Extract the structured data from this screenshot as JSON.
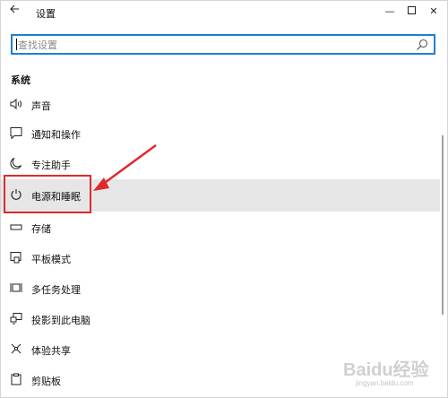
{
  "window": {
    "title": "设置",
    "back_icon": "back-arrow-icon",
    "minimize": "—",
    "close": "✕"
  },
  "search": {
    "placeholder": "查找设置",
    "icon": "search-icon"
  },
  "section_title": "系统",
  "items": [
    {
      "label": "声音",
      "icon": "speaker-icon"
    },
    {
      "label": "通知和操作",
      "icon": "notification-icon"
    },
    {
      "label": "专注助手",
      "icon": "moon-icon"
    },
    {
      "label": "电源和睡眠",
      "icon": "power-icon",
      "selected": true
    },
    {
      "label": "存储",
      "icon": "storage-icon"
    },
    {
      "label": "平板模式",
      "icon": "tablet-mode-icon"
    },
    {
      "label": "多任务处理",
      "icon": "multitasking-icon"
    },
    {
      "label": "投影到此电脑",
      "icon": "project-icon"
    },
    {
      "label": "体验共享",
      "icon": "shared-experience-icon"
    },
    {
      "label": "剪贴板",
      "icon": "clipboard-icon"
    }
  ],
  "annotation": {
    "color": "#e02a2a"
  },
  "watermark": {
    "text": "Baidu经验",
    "sub": "jingyan.baidu.com"
  },
  "colors": {
    "accent": "#1e7fd6",
    "selected_bg": "#e6e6e6"
  }
}
